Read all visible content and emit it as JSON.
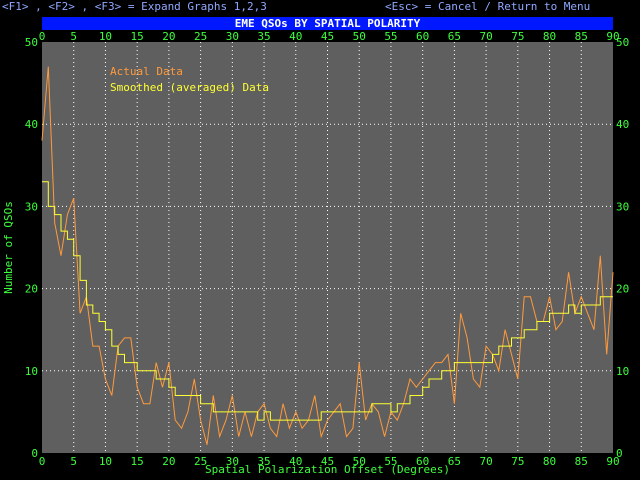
{
  "header": {
    "left_hint": "<F1> , <F2> , <F3> = Expand Graphs 1,2,3",
    "right_hint": "<Esc> = Cancel / Return to Menu"
  },
  "colors": {
    "background": "#000000",
    "plot_bg": "#5f5f5f",
    "title_bar": "#0018ff",
    "axis_text": "#3dff3d",
    "actual": "#ff9a3c",
    "smoothed": "#ffff33",
    "grid": "#ffffff"
  },
  "chart_data": {
    "type": "line",
    "title": "EME QSOs BY SPATIAL POLARITY",
    "xlabel": "Spatial Polarization Offset (Degrees)",
    "ylabel": "Number of QSOs",
    "xlim": [
      0,
      90
    ],
    "ylim": [
      0,
      50
    ],
    "x_ticks": [
      0,
      5,
      10,
      15,
      20,
      25,
      30,
      35,
      40,
      45,
      50,
      55,
      60,
      65,
      70,
      75,
      80,
      85,
      90
    ],
    "y_ticks": [
      0,
      10,
      20,
      30,
      40,
      50
    ],
    "grid": true,
    "legend_position": "top-left",
    "x": [
      0,
      1,
      2,
      3,
      4,
      5,
      6,
      7,
      8,
      9,
      10,
      11,
      12,
      13,
      14,
      15,
      16,
      17,
      18,
      19,
      20,
      21,
      22,
      23,
      24,
      25,
      26,
      27,
      28,
      29,
      30,
      31,
      32,
      33,
      34,
      35,
      36,
      37,
      38,
      39,
      40,
      41,
      42,
      43,
      44,
      45,
      46,
      47,
      48,
      49,
      50,
      51,
      52,
      53,
      54,
      55,
      56,
      57,
      58,
      59,
      60,
      61,
      62,
      63,
      64,
      65,
      66,
      67,
      68,
      69,
      70,
      71,
      72,
      73,
      74,
      75,
      76,
      77,
      78,
      79,
      80,
      81,
      82,
      83,
      84,
      85,
      86,
      87,
      88,
      89,
      90
    ],
    "series": [
      {
        "name": "Actual Data",
        "values": [
          38,
          47,
          28,
          24,
          29,
          31,
          17,
          19,
          13,
          13,
          9,
          7,
          13,
          14,
          14,
          8,
          6,
          6,
          11,
          8,
          11,
          4,
          3,
          5,
          9,
          4,
          1,
          7,
          2,
          4,
          7,
          2,
          5,
          2,
          5,
          6,
          3,
          2,
          6,
          3,
          5,
          3,
          4,
          7,
          2,
          4,
          5,
          6,
          2,
          3,
          11,
          4,
          6,
          5,
          2,
          5,
          4,
          6,
          9,
          8,
          9,
          10,
          11,
          11,
          12,
          6,
          17,
          14,
          9,
          8,
          13,
          12,
          10,
          15,
          12,
          9,
          19,
          19,
          16,
          16,
          19,
          15,
          16,
          22,
          17,
          19,
          17,
          15,
          24,
          12,
          22
        ]
      },
      {
        "name": "Smoothed (averaged) Data",
        "values": [
          33,
          30,
          29,
          27,
          26,
          24,
          21,
          18,
          17,
          16,
          15,
          13,
          12,
          11,
          11,
          10,
          10,
          10,
          9,
          9,
          8,
          7,
          7,
          7,
          7,
          6,
          6,
          5,
          5,
          5,
          5,
          5,
          5,
          5,
          4,
          5,
          4,
          4,
          4,
          4,
          4,
          4,
          4,
          4,
          5,
          5,
          5,
          5,
          5,
          5,
          5,
          5,
          6,
          6,
          6,
          5,
          6,
          6,
          7,
          7,
          8,
          9,
          9,
          10,
          10,
          11,
          11,
          11,
          11,
          11,
          11,
          12,
          13,
          13,
          14,
          14,
          15,
          15,
          16,
          16,
          17,
          17,
          17,
          18,
          17,
          18,
          18,
          18,
          19,
          19,
          19
        ]
      }
    ]
  }
}
